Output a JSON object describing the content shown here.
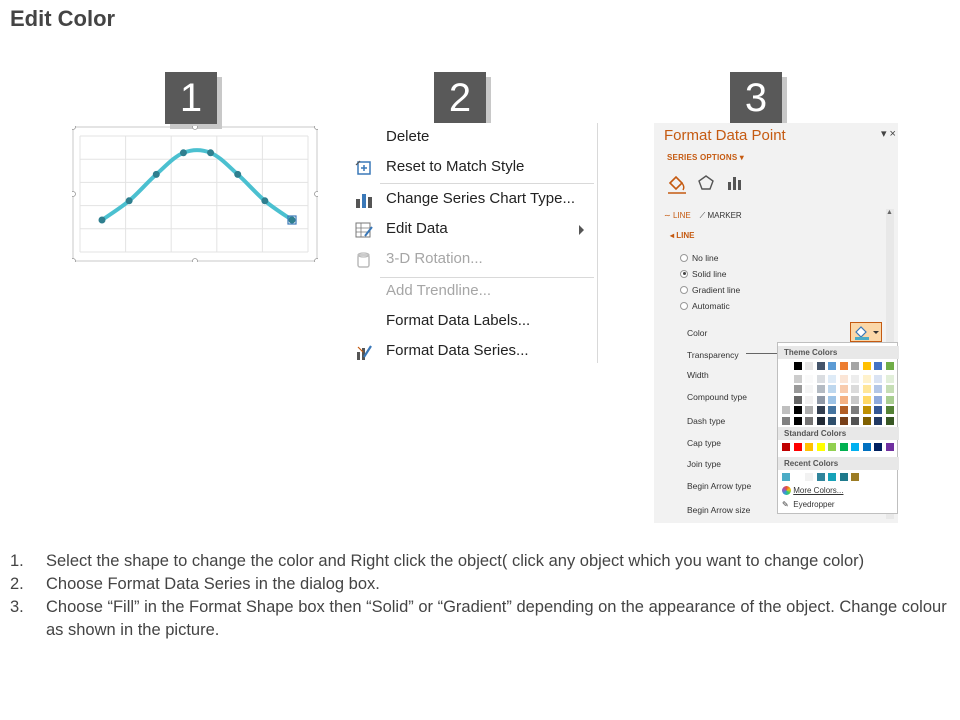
{
  "page": {
    "title": "Edit Color"
  },
  "steps": [
    "1",
    "2",
    "3"
  ],
  "context_menu": {
    "items": [
      {
        "label": "Delete",
        "icon": "none",
        "disabled": false
      },
      {
        "label": "Reset to Match Style",
        "icon": "reset-style-icon",
        "disabled": false
      },
      {
        "label": "Change Series Chart Type...",
        "icon": "bar-chart-icon",
        "disabled": false
      },
      {
        "label": "Edit Data",
        "icon": "edit-data-icon",
        "disabled": false,
        "submenu": true
      },
      {
        "label": "3-D Rotation...",
        "icon": "rotation-3d-icon",
        "disabled": true
      },
      {
        "label": "Add Trendline...",
        "icon": "none",
        "disabled": true
      },
      {
        "label": "Format Data Labels...",
        "icon": "none",
        "disabled": false
      },
      {
        "label": "Format Data Series...",
        "icon": "format-series-icon",
        "disabled": false
      }
    ]
  },
  "format_pane": {
    "title": "Format Data Point",
    "controls": "▾ ×",
    "series_options": "SERIES OPTIONS ▾",
    "tabs": [
      "LINE",
      "MARKER"
    ],
    "section": "LINE",
    "line_options": [
      {
        "label": "No line",
        "selected": false
      },
      {
        "label": "Solid line",
        "selected": true
      },
      {
        "label": "Gradient line",
        "selected": false
      },
      {
        "label": "Automatic",
        "selected": false
      }
    ],
    "properties": [
      "Color",
      "Transparency",
      "Width",
      "Compound type",
      "Dash type",
      "Cap type",
      "Join type",
      "Begin Arrow type",
      "Begin Arrow size"
    ]
  },
  "palette": {
    "theme_header": "Theme Colors",
    "standard_header": "Standard Colors",
    "recent_header": "Recent Colors",
    "more_colors": "More Colors...",
    "eyedropper": "Eyedropper",
    "theme_top": [
      "#ffffff",
      "#000000",
      "#e7e6e6",
      "#44546a",
      "#5b9bd5",
      "#ed7d31",
      "#a5a5a5",
      "#ffc000",
      "#4472c4",
      "#70ad47"
    ],
    "standard": [
      "#c00000",
      "#ff0000",
      "#ffc000",
      "#ffff00",
      "#92d050",
      "#00b050",
      "#00b0f0",
      "#0070c0",
      "#002060",
      "#7030a0"
    ],
    "recent": [
      "#4bacc6",
      "#ffffff",
      "#f2f2f2",
      "#31859c",
      "#17a2b8",
      "#1f7a8c",
      "#9c7c24"
    ]
  },
  "chart_data": {
    "type": "line",
    "x": [
      1,
      2,
      3,
      4,
      5,
      6,
      7,
      8
    ],
    "values": [
      0.5,
      1.3,
      2.4,
      3.3,
      3.3,
      2.4,
      1.3,
      0.5
    ],
    "ylim": [
      0,
      4
    ],
    "grid": true,
    "series_color": "#4bc0d0"
  },
  "instructions": [
    {
      "num": "1.",
      "text": "Select the shape to change the color and Right click the object( click any object which you want to change color)"
    },
    {
      "num": "2.",
      "text": "Choose Format Data Series in the dialog box."
    },
    {
      "num": "3.",
      "text": "Choose “Fill” in the Format Shape box then “Solid” or “Gradient” depending on the appearance of the object. Change colour as shown in the picture."
    }
  ]
}
